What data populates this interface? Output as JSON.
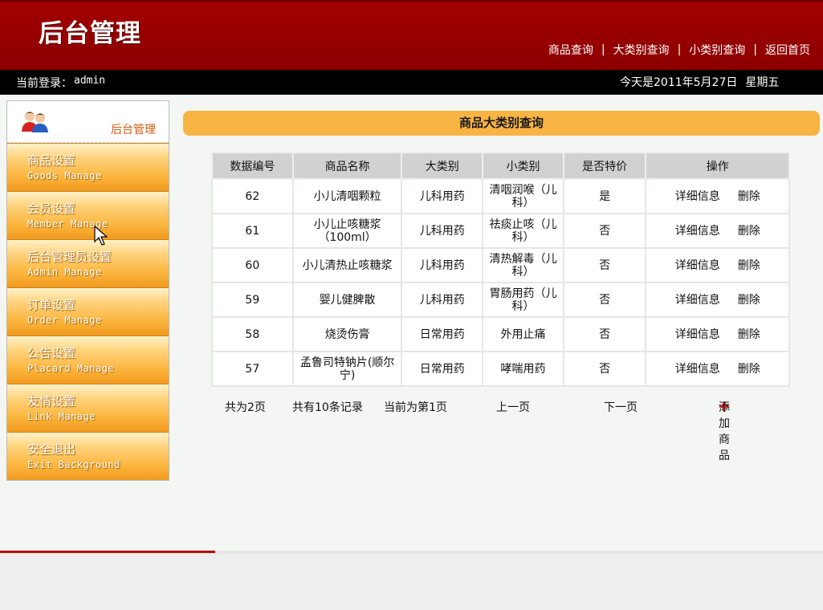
{
  "header": {
    "logo": "后台管理",
    "nav": [
      "商品查询",
      "大类别查询",
      "小类别查询",
      "返回首页"
    ]
  },
  "infobar": {
    "login_label": "当前登录：",
    "user": "admin",
    "date": "今天是2011年5月27日",
    "weekday": "星期五"
  },
  "sidebar": {
    "title": "后台管理",
    "items": [
      {
        "cn": "商品设置",
        "en": "Goods Manage"
      },
      {
        "cn": "会员设置",
        "en": "Member Manage"
      },
      {
        "cn": "后台管理员设置",
        "en": "Admin Manage"
      },
      {
        "cn": "订单设置",
        "en": "Order Manage"
      },
      {
        "cn": "公告设置",
        "en": "Placard Manage"
      },
      {
        "cn": "友情设置",
        "en": "Link Manage"
      },
      {
        "cn": "安全退出",
        "en": "Exit Background"
      }
    ]
  },
  "main": {
    "title": "商品大类别查询",
    "columns": [
      "数据编号",
      "商品名称",
      "大类别",
      "小类别",
      "是否特价",
      "操作"
    ],
    "rows": [
      {
        "id": "62",
        "name": "小儿清咽颗粒",
        "major": "儿科用药",
        "minor": "清咽润喉（儿科）",
        "special": "是"
      },
      {
        "id": "61",
        "name": "小儿止咳糖浆（100ml）",
        "major": "儿科用药",
        "minor": "祛痰止咳（儿科）",
        "special": "否"
      },
      {
        "id": "60",
        "name": "小儿清热止咳糖浆",
        "major": "儿科用药",
        "minor": "清热解毒（儿科）",
        "special": "否"
      },
      {
        "id": "59",
        "name": "婴儿健脾散",
        "major": "儿科用药",
        "minor": "胃肠用药（儿科）",
        "special": "否"
      },
      {
        "id": "58",
        "name": "烧烫伤膏",
        "major": "日常用药",
        "minor": "外用止痛",
        "special": "否"
      },
      {
        "id": "57",
        "name": "孟鲁司特钠片(顺尔宁)",
        "major": "日常用药",
        "minor": "哮喘用药",
        "special": "否"
      }
    ],
    "op_detail": "详细信息",
    "op_delete": "删除"
  },
  "pager": {
    "total_pages": "共为2页",
    "total_records": "共有10条记录",
    "current": "当前为第1页",
    "prev": "上一页",
    "next": "下一页",
    "add": "添加商品"
  }
}
